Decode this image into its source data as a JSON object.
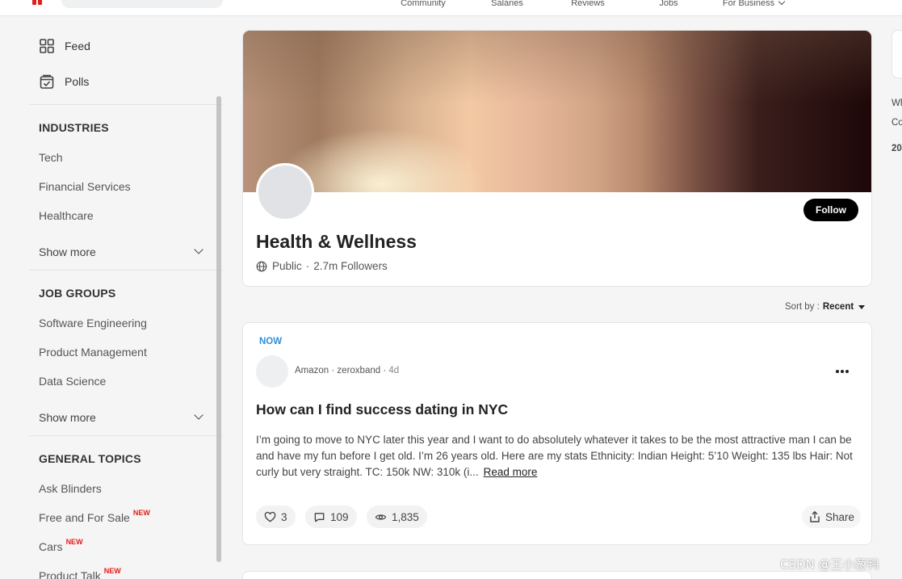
{
  "topnav": {
    "links": [
      {
        "label": "Community",
        "width": 108
      },
      {
        "label": "Salaries",
        "width": 100
      },
      {
        "label": "Reviews",
        "width": 100
      },
      {
        "label": "Jobs",
        "width": 100
      },
      {
        "label": "For Business",
        "width": 110
      }
    ]
  },
  "sidebar": {
    "feed_label": "Feed",
    "polls_label": "Polls",
    "industries": {
      "title": "INDUSTRIES",
      "items": [
        "Tech",
        "Financial Services",
        "Healthcare"
      ],
      "show_more": "Show more"
    },
    "job_groups": {
      "title": "JOB GROUPS",
      "items": [
        "Software Engineering",
        "Product Management",
        "Data Science"
      ],
      "show_more": "Show more"
    },
    "general_topics": {
      "title": "GENERAL TOPICS",
      "items": [
        {
          "label": "Ask Blinders",
          "badge": ""
        },
        {
          "label": "Free and For Sale",
          "badge": "NEW"
        },
        {
          "label": "Cars",
          "badge": "NEW"
        },
        {
          "label": "Product Talk",
          "badge": "NEW"
        }
      ]
    }
  },
  "topic": {
    "title": "Health & Wellness",
    "visibility": "Public",
    "followers": "2.7m Followers",
    "follow_label": "Follow"
  },
  "sort": {
    "label": "Sort by :",
    "value": "Recent"
  },
  "post": {
    "badge": "NOW",
    "company": "Amazon",
    "username": "zeroxband",
    "time": "4d",
    "title": "How can I find success dating in NYC",
    "body": "I’m going to move to NYC later this year and I want to do absolutely whatever it takes to be the most attractive man I can be and have my fun before I get old. I’m 26 years old.  Here are my stats  Ethnicity: Indian Height: 5’10 Weight: 135 lbs Hair: Not curly but very straight. TC: 150k NW: 310k (i...",
    "read_more": "Read more",
    "likes": "3",
    "comments": "109",
    "views": "1,835",
    "share_label": "Share"
  },
  "right_panel": {
    "line1": "Wh",
    "line2": "Co",
    "line3": "20"
  },
  "watermark": "CSDN @王小葱鸭",
  "colors": {
    "accent_blue": "#2f8fd8",
    "new_badge": "#e0201b",
    "follow_bg": "#000000"
  }
}
